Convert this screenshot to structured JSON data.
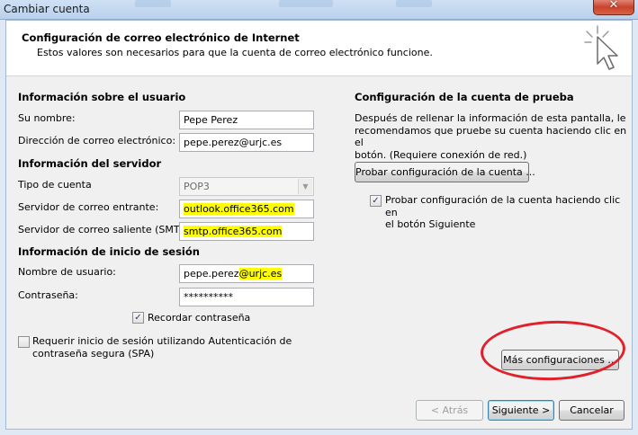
{
  "window": {
    "title": "Cambiar cuenta",
    "close_glyph": "✕"
  },
  "header": {
    "title": "Configuración de correo electrónico de Internet",
    "subtitle": "Estos valores son necesarios para que la cuenta de correo electrónico funcione."
  },
  "user_info": {
    "heading": "Información sobre el usuario",
    "name_label": "Su nombre:",
    "name_value": "Pepe Perez",
    "email_label": "Dirección de correo electrónico:",
    "email_value": "pepe.perez@urjc.es"
  },
  "server_info": {
    "heading": "Información del servidor",
    "account_type_label": "Tipo de cuenta",
    "account_type_value": "POP3",
    "incoming_label": "Servidor de correo entrante:",
    "incoming_value": "outlook.office365.com",
    "outgoing_label": "Servidor de correo saliente (SMTP):",
    "outgoing_value": "smtp.office365.com"
  },
  "login_info": {
    "heading": "Información de inicio de sesión",
    "username_label": "Nombre de usuario:",
    "username_prefix": "pepe.perez",
    "username_domain": "@urjc.es",
    "password_label": "Contraseña:",
    "password_value": "**********",
    "remember_label": "Recordar contraseña",
    "remember_checked": true,
    "spa_label_line1": "Requerir inicio de sesión utilizando Autenticación de",
    "spa_label_line2": "contraseña segura (SPA)",
    "spa_checked": false
  },
  "test_settings": {
    "heading": "Configuración de la cuenta de prueba",
    "description_line1": "Después de rellenar la información de esta pantalla, le",
    "description_line2": "recomendamos que pruebe su cuenta haciendo clic en el",
    "description_line3": "botón. (Requiere conexión de red.)",
    "test_button": "Probar configuración de la cuenta ...",
    "auto_test_line1": "Probar configuración de la cuenta haciendo clic en",
    "auto_test_line2": "el botón Siguiente",
    "auto_test_checked": true
  },
  "more_settings_button": "Más configuraciones ...",
  "footer": {
    "back_button": "< Atrás",
    "next_button": "Siguiente >",
    "cancel_button": "Cancelar"
  },
  "colors": {
    "highlight": "#ffff00",
    "annotation_oval": "#e0202a",
    "dialog_bg": "#f0f0f0"
  },
  "icons": {
    "header_icon": "cursor-click-icon",
    "checkmark": "✓"
  }
}
